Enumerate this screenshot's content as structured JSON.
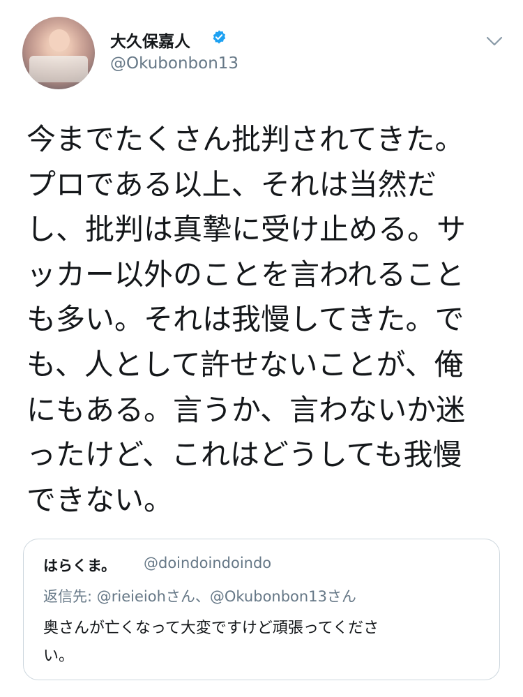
{
  "tweet": {
    "author_name": "大久保嘉人",
    "handle": "@Okubonbon13",
    "verified_icon": "verified-badge-icon",
    "menu_icon": "chevron-down-icon",
    "text_lines": [
      "今までたくさん批判されてきた。",
      "プロである以上、それは当然だ",
      "し、批判は真摯に受け止める。サ",
      "ッカー以外のことを言われること",
      "も多い。それは我慢してきた。で",
      "も、人として許せないことが、俺",
      "にもある。言うか、言わないか迷",
      "ったけど、これはどうしても我慢",
      "できない。"
    ]
  },
  "quoted": {
    "author_name": "はらくま。",
    "handle": "@doindoindoindo",
    "reply_to": "返信先: @rieieiohさん、@Okubonbon13さん",
    "text_lines": [
      "奥さんが亡くなって大変ですけど頑張ってくださ",
      "い。"
    ]
  },
  "colors": {
    "text": "#14171a",
    "secondary": "#657786",
    "verified": "#1da1f2",
    "border": "#ccd6dd"
  }
}
